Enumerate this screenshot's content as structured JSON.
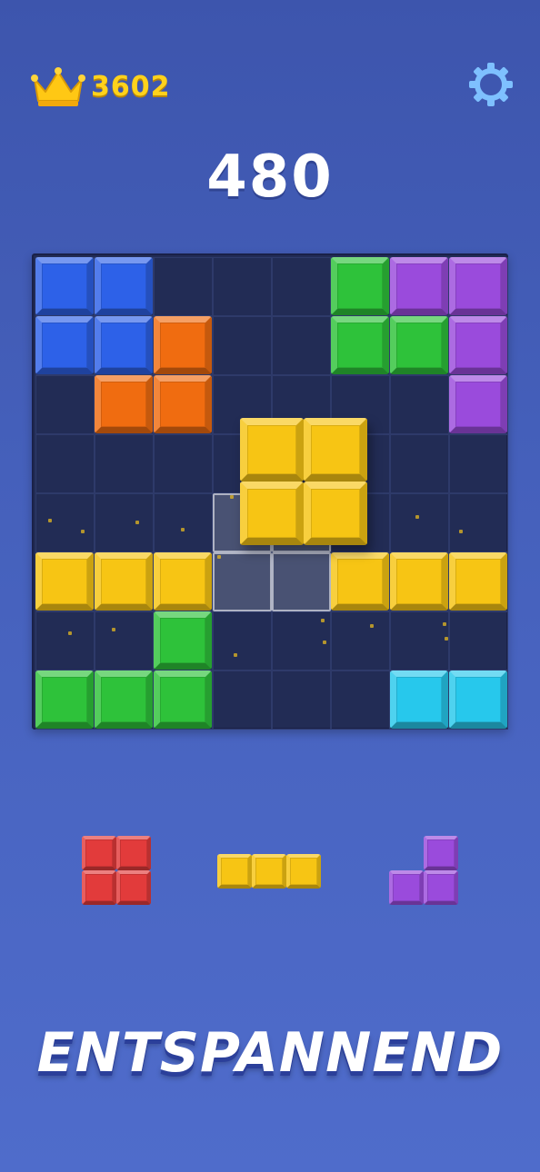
{
  "hud": {
    "best_score": "3602",
    "current_score": "480",
    "crown_icon": "crown-icon",
    "settings_icon": "gear-icon"
  },
  "colors": {
    "blue": "#2d61e8",
    "orange": "#f06c10",
    "green": "#2ec23a",
    "purple": "#9a4bdc",
    "yellow": "#f7c514",
    "cyan": "#27c8ec",
    "red": "#e23b3b",
    "empty_cell": "#222c55"
  },
  "board": {
    "rows": 8,
    "cols": 8,
    "cells": [
      [
        "blue",
        "blue",
        "",
        "",
        "",
        "green",
        "purple",
        "purple"
      ],
      [
        "blue",
        "blue",
        "orange",
        "",
        "",
        "green",
        "green",
        "purple"
      ],
      [
        "",
        "orange",
        "orange",
        "",
        "",
        "",
        "",
        "purple"
      ],
      [
        "",
        "",
        "",
        "",
        "",
        "",
        "",
        ""
      ],
      [
        "",
        "",
        "",
        "",
        "",
        "",
        "",
        ""
      ],
      [
        "yellow",
        "yellow",
        "yellow",
        "",
        "",
        "yellow",
        "yellow",
        "yellow"
      ],
      [
        "",
        "",
        "green",
        "",
        "",
        "",
        "",
        ""
      ],
      [
        "green",
        "green",
        "green",
        "",
        "",
        "",
        "cyan",
        "cyan"
      ]
    ],
    "placement_preview": [
      [
        4,
        3
      ],
      [
        4,
        4
      ],
      [
        5,
        3
      ],
      [
        5,
        4
      ]
    ],
    "dragging_piece": {
      "color": "yellow",
      "cells": [
        [
          0,
          0
        ],
        [
          0,
          1
        ],
        [
          1,
          0
        ],
        [
          1,
          1
        ]
      ]
    }
  },
  "tray": {
    "pieces": [
      {
        "name": "square-2x2",
        "color": "red",
        "cells": [
          [
            0,
            0
          ],
          [
            0,
            1
          ],
          [
            1,
            0
          ],
          [
            1,
            1
          ]
        ]
      },
      {
        "name": "line-3",
        "color": "yellow",
        "cells": [
          [
            0,
            0
          ],
          [
            0,
            1
          ],
          [
            0,
            2
          ]
        ]
      },
      {
        "name": "corner-3",
        "color": "purple",
        "cells": [
          [
            0,
            1
          ],
          [
            1,
            0
          ],
          [
            1,
            1
          ]
        ]
      }
    ]
  },
  "banner": {
    "text": "ENTSPANNEND"
  }
}
